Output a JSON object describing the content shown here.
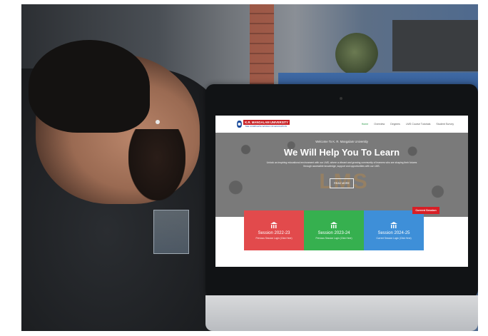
{
  "website": {
    "logo": {
      "line1": "K.R. MANGALAM UNIVERSITY",
      "line2": "THE COMPLETE WORLD OF EDUCATION"
    },
    "nav": [
      "Home",
      "Overview",
      "Degrees",
      "LMS Course Tutorials",
      "Student Survey"
    ],
    "hero": {
      "welcome": "Welcome To K. R. Mangalam University",
      "title": "We Will Help You To Learn",
      "description": "Unlock an inspiring educational environment with our LMS, where a vibrant and growing community of learners who are shaping their futures through accessible knowledge, support and opportunities with our LMS.",
      "button": "READ MORE",
      "watermark": "LMS"
    },
    "current_badge": "Current Session",
    "sessions": [
      {
        "name": "Session 2022-23",
        "sub": "Previous Session Login (Click Here)",
        "color": "#e24a4c"
      },
      {
        "name": "Session 2023-24",
        "sub": "Previous Session Login (Click Here)",
        "color": "#36b04f"
      },
      {
        "name": "Session 2024-25",
        "sub": "Current Session Login (Click Here)",
        "color": "#3e8fd8"
      }
    ]
  }
}
